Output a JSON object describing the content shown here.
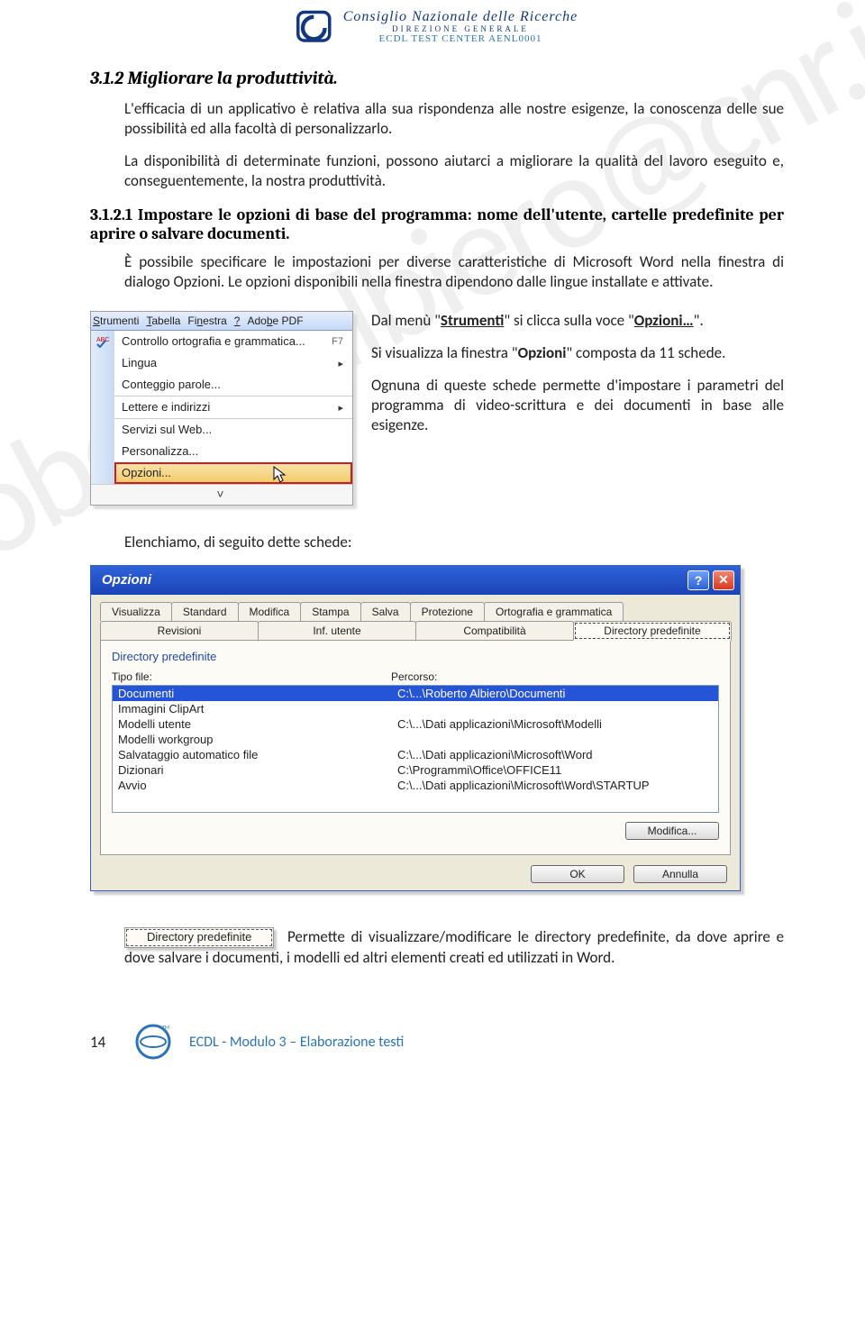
{
  "header": {
    "line1": "Consiglio Nazionale delle Ricerche",
    "line2": "DIREZIONE  GENERALE",
    "line3": "ECDL TEST CENTER AENL0001"
  },
  "watermark": "roberto.albiero@cnr.it",
  "section_3_1_2": {
    "title": "3.1.2  Migliorare la produttività.",
    "p1": "L'efficacia di un applicativo è relativa alla sua rispondenza alle nostre esigenze, la conoscenza delle sue possibilità ed alla facoltà di personalizzarlo.",
    "p2": "La disponibilità di determinate funzioni, possono aiutarci a migliorare la qualità del lavoro eseguito e, conseguentemente, la nostra produttività."
  },
  "section_3_1_2_1": {
    "title": "3.1.2.1 Impostare le opzioni di base del programma: nome dell'utente, cartelle predefinite per aprire o salvare documenti.",
    "p1": "È possibile specificare le impostazioni per diverse caratteristiche di Microsoft Word nella finestra di dialogo Opzioni. Le opzioni disponibili nella finestra dipendono dalle lingue installate e attivate."
  },
  "word_menu": {
    "menubar": [
      "Strumenti",
      "Tabella",
      "Finestra",
      "?",
      "Adobe PDF"
    ],
    "items": [
      {
        "label": "Controllo ortografia e grammatica...",
        "shortcut": "F7",
        "icon": "abc"
      },
      {
        "label": "Lingua",
        "submenu": true
      },
      {
        "label": "Conteggio parole..."
      },
      {
        "label": "Lettere e indirizzi",
        "submenu": true,
        "sep": true
      },
      {
        "label": "Servizi sul Web...",
        "sep": true
      },
      {
        "label": "Personalizza..."
      },
      {
        "label": "Opzioni...",
        "highlighted": true
      }
    ],
    "chevrons": "˅"
  },
  "right_text": {
    "p1_a": "Dal menù \"",
    "p1_b": "Strumenti",
    "p1_c": "\" si clicca sulla voce \"",
    "p1_d": "Opzioni…",
    "p1_e": "\".",
    "p2_a": "Si visualizza la finestra \"",
    "p2_b": "Opzioni",
    "p2_c": "\" composta da 11 schede.",
    "p3": "Ognuna di queste schede permette d'impostare i parametri del programma di video-scrittura e dei documenti in base alle esigenze."
  },
  "after_menu_p": "Elenchiamo, di seguito dette schede:",
  "dialog": {
    "title": "Opzioni",
    "tabs_row1": [
      "Visualizza",
      "Standard",
      "Modifica",
      "Stampa",
      "Salva",
      "Protezione",
      "Ortografia e grammatica"
    ],
    "tabs_row2": [
      "Revisioni",
      "Inf. utente",
      "Compatibilità",
      "Directory predefinite"
    ],
    "active_tab": "Directory predefinite",
    "group": "Directory predefinite",
    "col_left": "Tipo file:",
    "col_right": "Percorso:",
    "rows": [
      {
        "name": "Documenti",
        "path": "C:\\...\\Roberto Albiero\\Documenti",
        "selected": true
      },
      {
        "name": "Immagini ClipArt",
        "path": ""
      },
      {
        "name": "Modelli utente",
        "path": "C:\\...\\Dati applicazioni\\Microsoft\\Modelli"
      },
      {
        "name": "Modelli workgroup",
        "path": ""
      },
      {
        "name": "Salvataggio automatico file",
        "path": "C:\\...\\Dati applicazioni\\Microsoft\\Word"
      },
      {
        "name": "Dizionari",
        "path": "C:\\Programmi\\Office\\OFFICE11"
      },
      {
        "name": "Avvio",
        "path": "C:\\...\\Dati applicazioni\\Microsoft\\Word\\STARTUP"
      }
    ],
    "btn_modify": "Modifica...",
    "btn_ok": "OK",
    "btn_cancel": "Annulla"
  },
  "chip_label": "Directory predefinite",
  "tail_para": " Permette di visualizzare/modificare le directory predefinite, da dove aprire e dove salvare i documenti, i modelli ed altri elementi creati ed utilizzati in Word.",
  "footer": {
    "page": "14",
    "module": "ECDL - Modulo 3 – Elaborazione testi"
  }
}
